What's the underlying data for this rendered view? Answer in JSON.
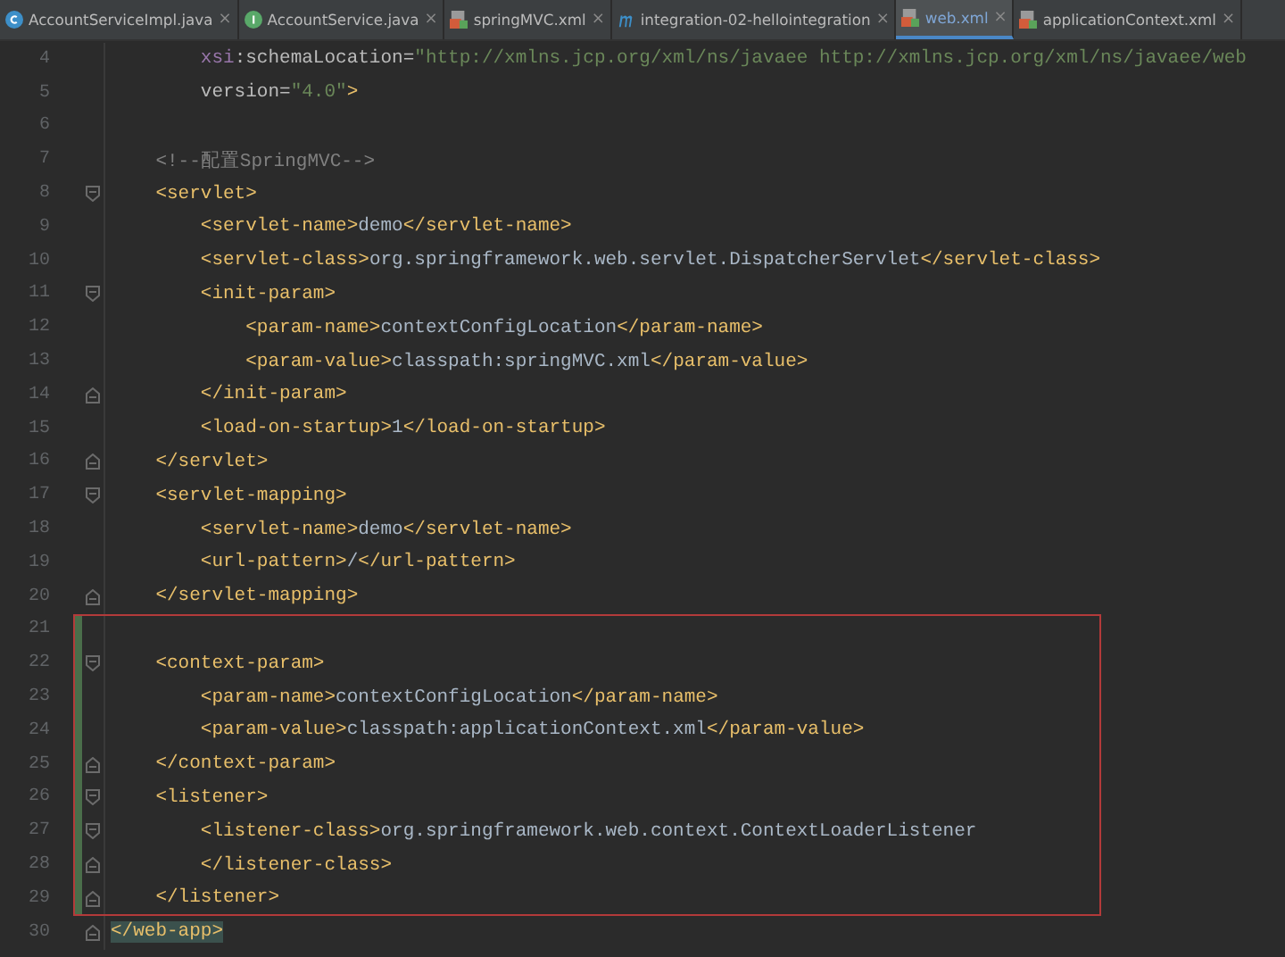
{
  "tabs": [
    {
      "label": "AccountServiceImpl.java",
      "kind": "class",
      "selected": false,
      "close": "×"
    },
    {
      "label": "AccountService.java",
      "kind": "interface",
      "selected": false,
      "close": "×"
    },
    {
      "label": "springMVC.xml",
      "kind": "xml",
      "selected": false,
      "close": "×"
    },
    {
      "label": "integration-02-hellointegration",
      "kind": "module",
      "selected": false,
      "close": "×"
    },
    {
      "label": "web.xml",
      "kind": "xml",
      "selected": true,
      "close": "×"
    },
    {
      "label": "applicationContext.xml",
      "kind": "xml",
      "selected": false,
      "close": "×"
    }
  ],
  "blocks": [
    {
      "boxed": false,
      "lines": [
        {
          "number": "4",
          "kind": "plain",
          "changed": false,
          "tokens": [
            {
              "kind": "ns",
              "text": "        xsi"
            },
            {
              "kind": "attr",
              "text": ":schemaLocation="
            },
            {
              "kind": "value",
              "text": "\"http://xmlns.jcp.org/xml/ns/javaee http://xmlns.jcp.org/xml/ns/javaee/web"
            }
          ]
        },
        {
          "number": "5",
          "kind": "plain",
          "changed": false,
          "tokens": [
            {
              "kind": "attr",
              "text": "        version="
            },
            {
              "kind": "value",
              "text": "\"4.0\""
            },
            {
              "kind": "tag",
              "text": ">"
            }
          ]
        },
        {
          "number": "6",
          "kind": "plain",
          "changed": false
        },
        {
          "number": "7",
          "kind": "plain",
          "changed": false,
          "tokens": [
            {
              "kind": "comment",
              "text": "    <!--配置SpringMVC-->"
            }
          ]
        },
        {
          "number": "8",
          "kind": "fold_open",
          "changed": false,
          "tokens": [
            {
              "kind": "tag",
              "text": "    <servlet>"
            }
          ]
        },
        {
          "number": "9",
          "kind": "plain",
          "changed": false,
          "tokens": [
            {
              "kind": "tag",
              "text": "        <servlet-name>"
            },
            {
              "kind": "text",
              "text": "demo"
            },
            {
              "kind": "tag",
              "text": "</servlet-name>"
            }
          ]
        },
        {
          "number": "10",
          "kind": "plain",
          "changed": false,
          "tokens": [
            {
              "kind": "tag",
              "text": "        <servlet-class>"
            },
            {
              "kind": "text",
              "text": "org.springframework.web.servlet.DispatcherServlet"
            },
            {
              "kind": "tag",
              "text": "</servlet-class>"
            }
          ]
        },
        {
          "number": "11",
          "kind": "fold_open",
          "changed": false,
          "tokens": [
            {
              "kind": "tag",
              "text": "        <init-param>"
            }
          ]
        },
        {
          "number": "12",
          "kind": "plain",
          "changed": false,
          "tokens": [
            {
              "kind": "tag",
              "text": "            <param-name>"
            },
            {
              "kind": "text",
              "text": "contextConfigLocation"
            },
            {
              "kind": "tag",
              "text": "</param-name>"
            }
          ]
        },
        {
          "number": "13",
          "kind": "plain",
          "changed": false,
          "tokens": [
            {
              "kind": "tag",
              "text": "            <param-value>"
            },
            {
              "kind": "text",
              "text": "classpath:springMVC.xml"
            },
            {
              "kind": "tag",
              "text": "</param-value>"
            }
          ]
        },
        {
          "number": "14",
          "kind": "fold_close",
          "changed": false,
          "tokens": [
            {
              "kind": "tag",
              "text": "        </init-param>"
            }
          ]
        },
        {
          "number": "15",
          "kind": "plain",
          "changed": false,
          "tokens": [
            {
              "kind": "tag",
              "text": "        <load-on-startup>"
            },
            {
              "kind": "text",
              "text": "1"
            },
            {
              "kind": "tag",
              "text": "</load-on-startup>"
            }
          ]
        },
        {
          "number": "16",
          "kind": "fold_close",
          "changed": false,
          "tokens": [
            {
              "kind": "tag",
              "text": "    </servlet>"
            }
          ]
        },
        {
          "number": "17",
          "kind": "fold_open",
          "changed": false,
          "tokens": [
            {
              "kind": "tag",
              "text": "    <servlet-mapping>"
            }
          ]
        },
        {
          "number": "18",
          "kind": "plain",
          "changed": false,
          "tokens": [
            {
              "kind": "tag",
              "text": "        <servlet-name>"
            },
            {
              "kind": "text",
              "text": "demo"
            },
            {
              "kind": "tag",
              "text": "</servlet-name>"
            }
          ]
        },
        {
          "number": "19",
          "kind": "plain",
          "changed": false,
          "tokens": [
            {
              "kind": "tag",
              "text": "        <url-pattern>"
            },
            {
              "kind": "text",
              "text": "/"
            },
            {
              "kind": "tag",
              "text": "</url-pattern>"
            }
          ]
        },
        {
          "number": "20",
          "kind": "fold_close",
          "changed": false,
          "tokens": [
            {
              "kind": "tag",
              "text": "    </servlet-mapping>"
            }
          ]
        }
      ]
    },
    {
      "boxed": true,
      "lines": [
        {
          "number": "21",
          "kind": "plain",
          "changed": true
        },
        {
          "number": "22",
          "kind": "fold_open",
          "changed": true,
          "tokens": [
            {
              "kind": "tag",
              "text": "    <context-param>"
            }
          ]
        },
        {
          "number": "23",
          "kind": "plain",
          "changed": true,
          "tokens": [
            {
              "kind": "tag",
              "text": "        <param-name>"
            },
            {
              "kind": "text",
              "text": "contextConfigLocation"
            },
            {
              "kind": "tag",
              "text": "</param-name>"
            }
          ]
        },
        {
          "number": "24",
          "kind": "plain",
          "changed": true,
          "tokens": [
            {
              "kind": "tag",
              "text": "        <param-value>"
            },
            {
              "kind": "text",
              "text": "classpath:applicationContext.xml"
            },
            {
              "kind": "tag",
              "text": "</param-value>"
            }
          ]
        },
        {
          "number": "25",
          "kind": "fold_close",
          "changed": true,
          "tokens": [
            {
              "kind": "tag",
              "text": "    </context-param>"
            }
          ]
        },
        {
          "number": "26",
          "kind": "fold_open",
          "changed": true,
          "tokens": [
            {
              "kind": "tag",
              "text": "    <listener>"
            }
          ]
        },
        {
          "number": "27",
          "kind": "fold_open",
          "changed": true,
          "tokens": [
            {
              "kind": "tag",
              "text": "        <listener-class>"
            },
            {
              "kind": "text",
              "text": "org.springframework.web.context.ContextLoaderListener"
            }
          ]
        },
        {
          "number": "28",
          "kind": "fold_close",
          "changed": true,
          "tokens": [
            {
              "kind": "tag",
              "text": "        </listener-class>"
            }
          ]
        },
        {
          "number": "29",
          "kind": "fold_close",
          "changed": true,
          "tokens": [
            {
              "kind": "tag",
              "text": "    </listener>"
            }
          ]
        }
      ]
    },
    {
      "boxed": false,
      "lines": [
        {
          "number": "30",
          "kind": "fold_close",
          "changed": false,
          "tokens": [
            {
              "kind": "match",
              "text": "</web-app>"
            }
          ]
        }
      ]
    }
  ]
}
